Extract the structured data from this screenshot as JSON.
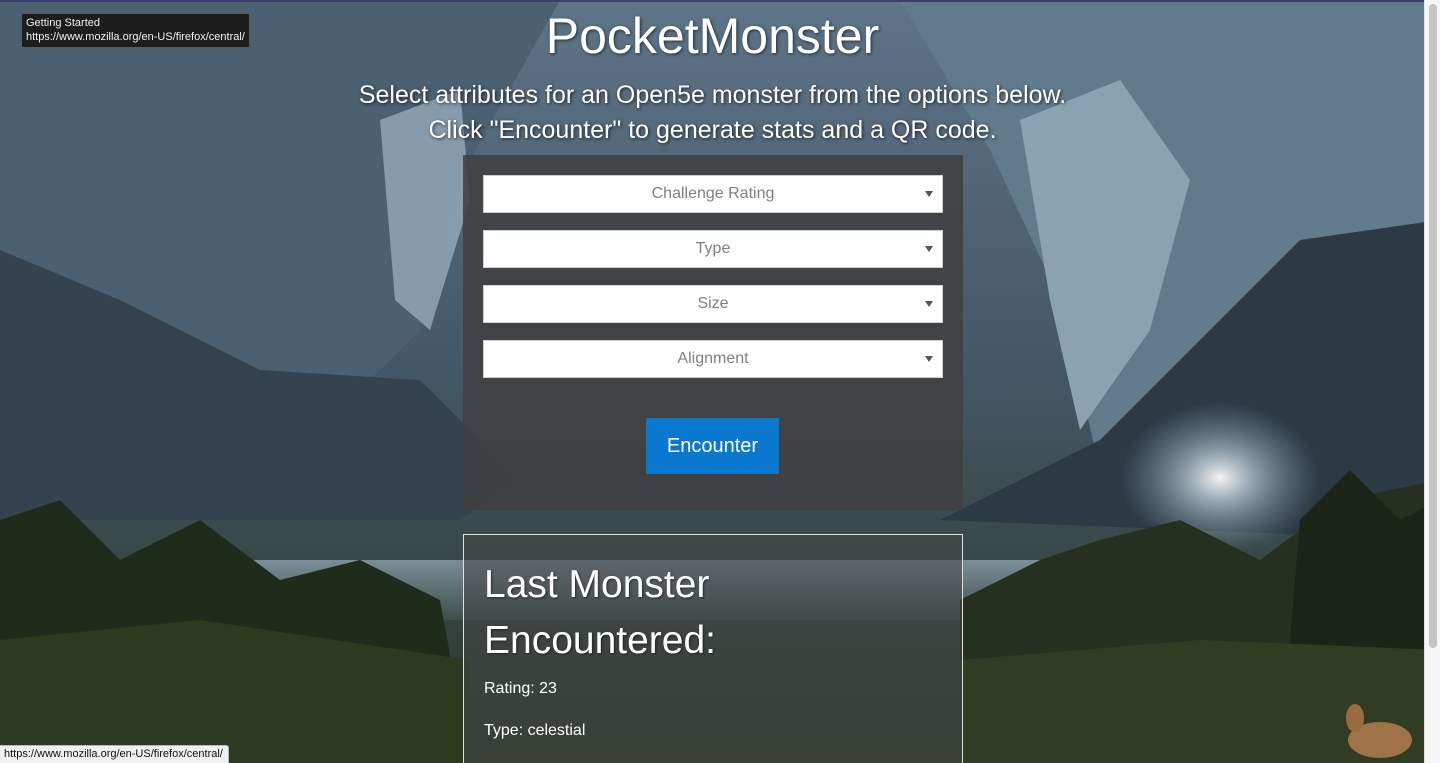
{
  "tooltip": {
    "title": "Getting Started",
    "url": "https://www.mozilla.org/en-US/firefox/central/"
  },
  "status_bar": {
    "url": "https://www.mozilla.org/en-US/firefox/central/"
  },
  "header": {
    "title": "PocketMonster",
    "subtitle_line1": "Select attributes for an Open5e monster from the options below.",
    "subtitle_line2": "Click \"Encounter\" to generate stats and a QR code."
  },
  "form": {
    "selects": [
      {
        "placeholder": "Challenge Rating"
      },
      {
        "placeholder": "Type"
      },
      {
        "placeholder": "Size"
      },
      {
        "placeholder": "Alignment"
      }
    ],
    "submit_label": "Encounter"
  },
  "result": {
    "title": "Last Monster Encountered:",
    "rating": "Rating: 23",
    "type": "Type: celestial"
  },
  "colors": {
    "button": "#0b78d0",
    "panel": "#404040"
  }
}
